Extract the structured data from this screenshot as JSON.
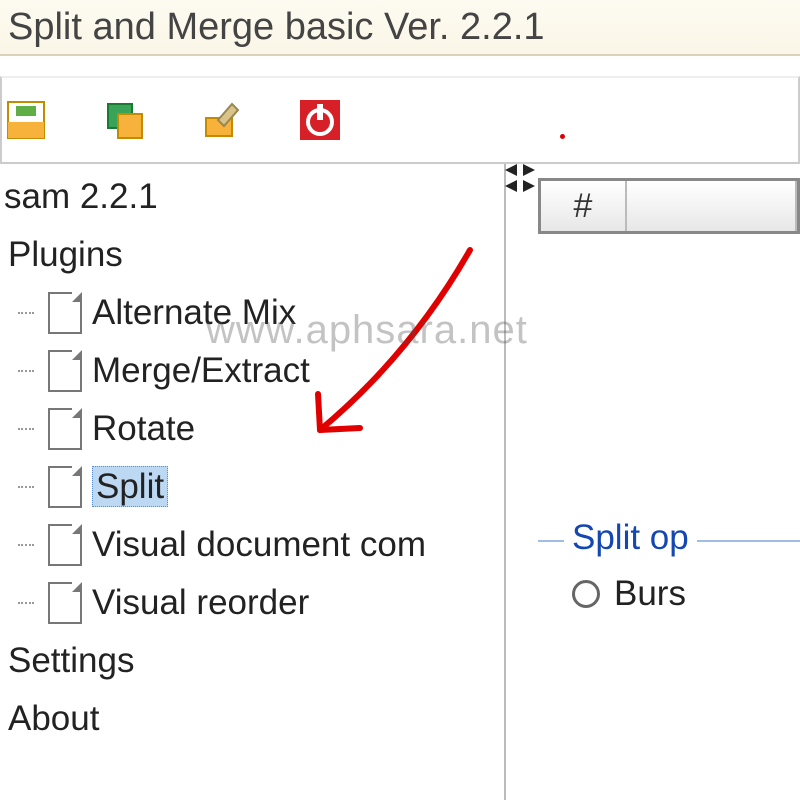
{
  "titlebar": {
    "text": " Split and Merge basic Ver. 2.2.1"
  },
  "toolbar": {
    "icons": [
      "save-icon",
      "copy-icon",
      "brush-icon",
      "power-icon"
    ]
  },
  "sidebar": {
    "root_label": "sam 2.2.1",
    "plugins_label": "Plugins",
    "items": [
      {
        "label": "Alternate Mix",
        "selected": false
      },
      {
        "label": "Merge/Extract",
        "selected": false
      },
      {
        "label": "Rotate",
        "selected": false
      },
      {
        "label": "Split",
        "selected": true
      },
      {
        "label": "Visual document com",
        "selected": false
      },
      {
        "label": "Visual reorder",
        "selected": false
      }
    ],
    "settings_label": "Settings",
    "about_label": "About"
  },
  "table": {
    "header_hash": "#"
  },
  "split_group": {
    "legend": "Split op",
    "radio1_label": "Burs"
  },
  "watermark": "www.aphsara.net"
}
